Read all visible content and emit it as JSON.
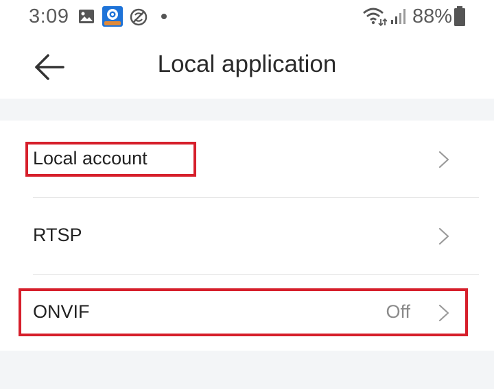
{
  "status_bar": {
    "time": "3:09",
    "battery_percent": "88%",
    "icons": [
      "image-icon",
      "camera-app-icon",
      "no-sync-icon",
      "notification-dot-icon",
      "wifi-icon",
      "signal-icon",
      "battery-icon"
    ]
  },
  "header": {
    "title": "Local application",
    "back_icon": "arrow-left-icon"
  },
  "settings": {
    "items": [
      {
        "label": "Local account",
        "value": ""
      },
      {
        "label": "RTSP",
        "value": ""
      },
      {
        "label": "ONVIF",
        "value": "Off"
      }
    ]
  },
  "colors": {
    "highlight": "#d61f2b",
    "section_background": "#f3f5f7",
    "value_text": "#8a8a8a"
  }
}
